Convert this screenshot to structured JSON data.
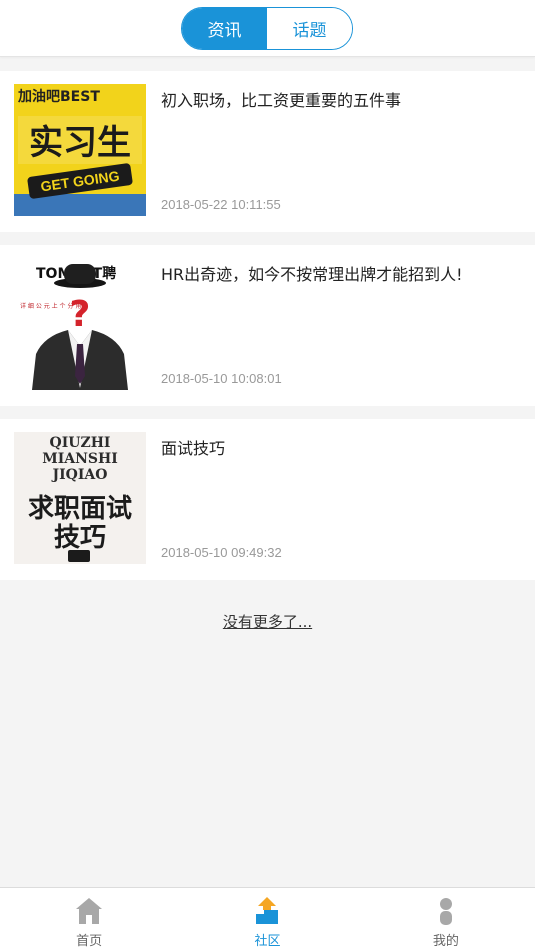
{
  "header": {
    "tabs": [
      {
        "label": "资讯",
        "active": true
      },
      {
        "label": "话题",
        "active": false
      }
    ]
  },
  "articles": [
    {
      "title": "初入职场，比工资更重要的五件事",
      "time": "2018-05-22 10:11:55",
      "thumb": {
        "line1": "加油吧BEST",
        "main": "实习生",
        "sub": "GET GOING"
      }
    },
    {
      "title": "HR出奇迹，如今不按常理出牌才能招到人!",
      "time": "2018-05-10 10:08:01",
      "thumb": {
        "line1": "TOMENT聘",
        "sub": "详 细 公 元 上 个 分 角",
        "mark": "?"
      }
    },
    {
      "title": "面试技巧",
      "time": "2018-05-10 09:49:32",
      "thumb": {
        "line1": "QIUZHI",
        "line2": "MIANSHI",
        "line3": "JIQIAO",
        "main": "求职面试",
        "main2": "技巧"
      }
    }
  ],
  "no_more": "没有更多了...",
  "tabbar": {
    "items": [
      {
        "label": "首页",
        "icon": "home-icon"
      },
      {
        "label": "社区",
        "icon": "community-icon"
      },
      {
        "label": "我的",
        "icon": "profile-icon"
      }
    ]
  },
  "colors": {
    "accent": "#1a93d8",
    "inactive_icon": "#a8a8a8",
    "community_orange": "#f5a623"
  }
}
